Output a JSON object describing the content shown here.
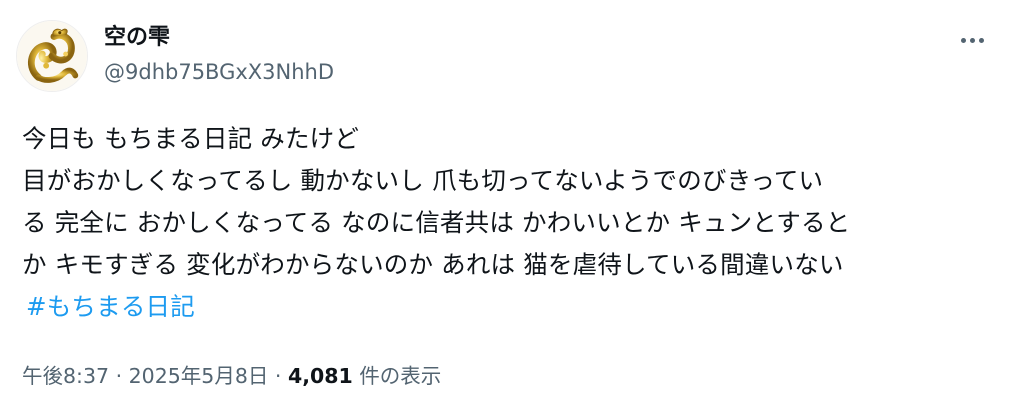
{
  "user": {
    "display_name": "空の雫",
    "handle": "@9dhb75BGxX3NhhD",
    "avatar_icon": "gold-dragon-avatar-icon"
  },
  "more_icon": "more-horizontal-icon",
  "post": {
    "lines": [
      "今日も もちまる日記 みたけど",
      "目がおかしくなってるし 動かないし 爪も切ってないようでのびきってい",
      "る 完全に おかしくなってる なのに信者共は かわいいとか キュンとすると",
      "か キモすぎる 変化がわからないのか あれは 猫を虐待している間違いない"
    ],
    "hashtag": "#もちまる日記"
  },
  "meta": {
    "time": "午後8:37",
    "sep1": " · ",
    "date": "2025年5月8日",
    "sep2": " · ",
    "views_count": "4,081",
    "views_label": " 件の表示"
  },
  "colors": {
    "text": "#0f1419",
    "secondary": "#536471",
    "link": "#1d9bf0",
    "avatar_gold": "#c9a227"
  }
}
